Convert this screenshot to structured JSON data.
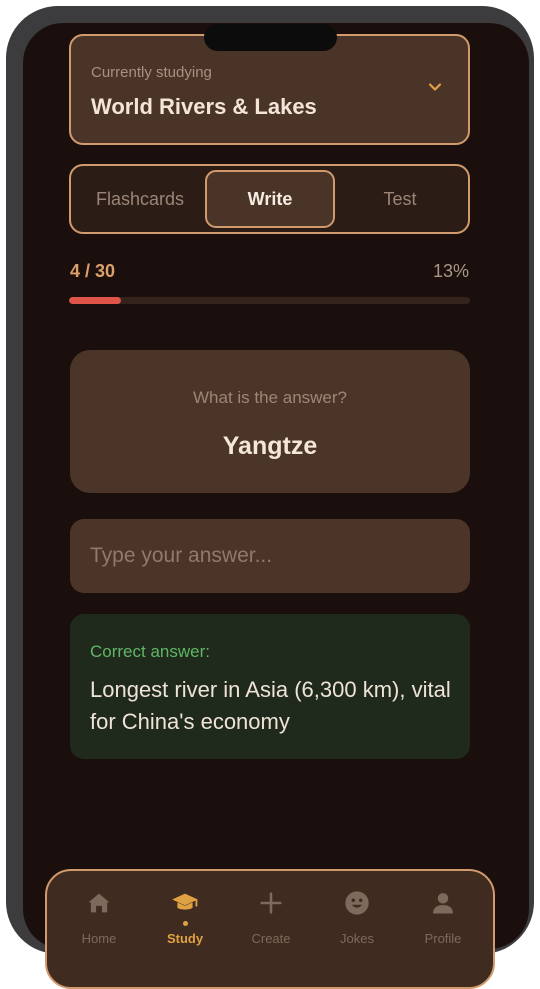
{
  "deck": {
    "caption": "Currently studying",
    "name": "World Rivers & Lakes"
  },
  "modes": {
    "tabs": [
      "Flashcards",
      "Write",
      "Test"
    ],
    "active": "Write"
  },
  "progress": {
    "count_text": "4 / 30",
    "percent_text": "13%",
    "fraction": 0.13
  },
  "question": {
    "prompt": "What is the answer?",
    "term": "Yangtze"
  },
  "answer_input": {
    "value": "",
    "placeholder": "Type your answer..."
  },
  "result": {
    "label": "Correct answer:",
    "text": "Longest river in Asia (6,300 km), vital for China's economy"
  },
  "nav": {
    "items": [
      {
        "label": "Home",
        "icon": "home-icon"
      },
      {
        "label": "Study",
        "icon": "graduation-cap-icon"
      },
      {
        "label": "Create",
        "icon": "plus-icon"
      },
      {
        "label": "Jokes",
        "icon": "smiley-icon"
      },
      {
        "label": "Profile",
        "icon": "person-icon"
      }
    ],
    "active": "Study"
  },
  "colors": {
    "accent": "#d19a6c",
    "active_nav": "#e0a143",
    "progress_fill": "#e05349",
    "correct": "#5fb664",
    "background": "#1a0f0c"
  }
}
